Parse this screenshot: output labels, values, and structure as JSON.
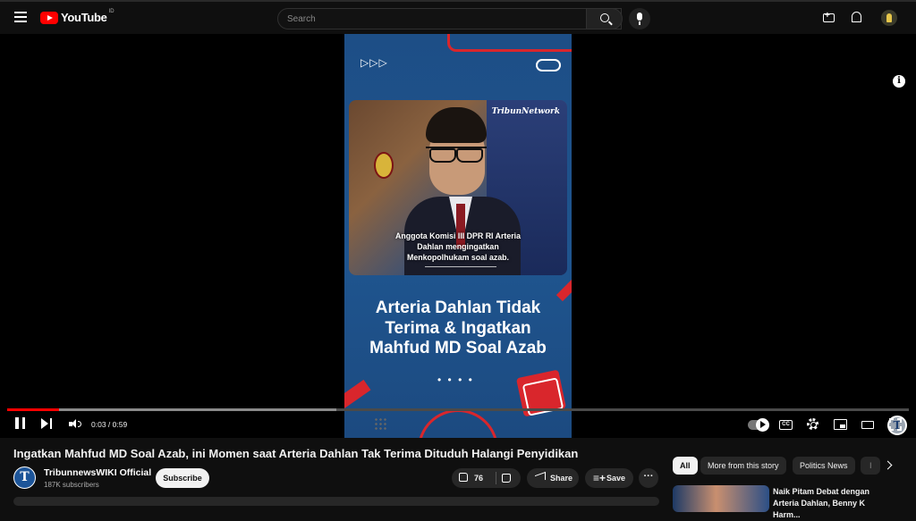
{
  "header": {
    "logo_text": "YouTube",
    "country_code": "ID",
    "search_placeholder": "Search"
  },
  "video": {
    "photo_watermark": "TribunNetwork",
    "photo_caption": [
      "Anggota  Komisi III DPR RI Arteria",
      "Dahlan mengingatkan",
      "Menkopolhukam soal azab."
    ],
    "headline": [
      "Arteria Dahlan Tidak",
      "Terima & Ingatkan",
      "Mahfud MD Soal Azab"
    ],
    "arrows": "▷▷▷",
    "dots": "• • • •",
    "channel_watermark": "T"
  },
  "player": {
    "time_current": "0:03",
    "time_total": "0:59",
    "time_display": "0:03 / 0:59",
    "progress_played_pct": 5.8,
    "progress_buffered_pct": 36.5,
    "cc_label": "CC",
    "info_label": "i"
  },
  "meta": {
    "title": "Ingatkan Mahfud MD Soal Azab, ini Momen saat Arteria Dahlan Tak Terima Dituduh Halangi Penyidikan",
    "channel_initial": "T",
    "channel_name": "TribunnewsWIKI Official",
    "subscribers": "187K subscribers",
    "subscribe_label": "Subscribe",
    "like_count": "76",
    "share_label": "Share",
    "save_label": "Save",
    "more_label": "···"
  },
  "sidebar": {
    "chips": [
      {
        "label": "All",
        "active": true
      },
      {
        "label": "More from this story",
        "active": false
      },
      {
        "label": "Politics News",
        "active": false
      },
      {
        "label": "I",
        "active": false
      }
    ],
    "related": [
      {
        "title": "Naik Pitam Debat dengan Arteria Dahlan, Benny K Harm..."
      }
    ]
  },
  "colors": {
    "accent_red": "#ff0000",
    "video_blue": "#1f558f",
    "brand_red": "#d9262c"
  }
}
